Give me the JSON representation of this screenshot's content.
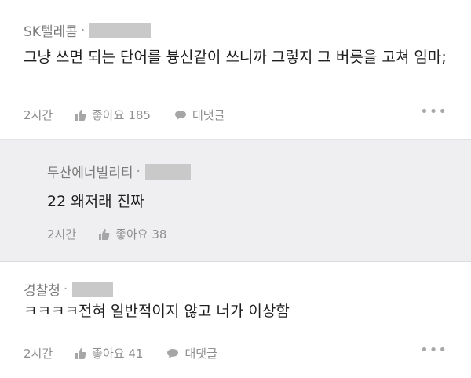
{
  "comments": [
    {
      "author": "SK텔레콤",
      "text": "그냥 쓰면 되는 단어를 븅신같이 쓰니까 그렇지 그 버릇을 고쳐 임마;",
      "time": "2시간",
      "like_label": "좋아요",
      "like_count": "185",
      "reply_label": "대댓글",
      "more": "•••"
    },
    {
      "author": "두산에너빌리티",
      "text": "22 왜저래 진짜",
      "time": "2시간",
      "like_label": "좋아요",
      "like_count": "38"
    },
    {
      "author": "경찰청",
      "text": "ㅋㅋㅋㅋ전혀 일반적이지 않고 너가 이상함",
      "time": "2시간",
      "like_label": "좋아요",
      "like_count": "41",
      "reply_label": "대댓글",
      "more": "•••"
    }
  ],
  "separator": "·",
  "colors": {
    "reply_bg": "#efeff1",
    "text": "#1e1e1e",
    "meta": "#8e8e8e",
    "blur": "#c9c9c9"
  },
  "icons": {
    "like": "thumbs-up-icon",
    "reply": "speech-bubble-icon",
    "more": "more-dots-icon"
  }
}
